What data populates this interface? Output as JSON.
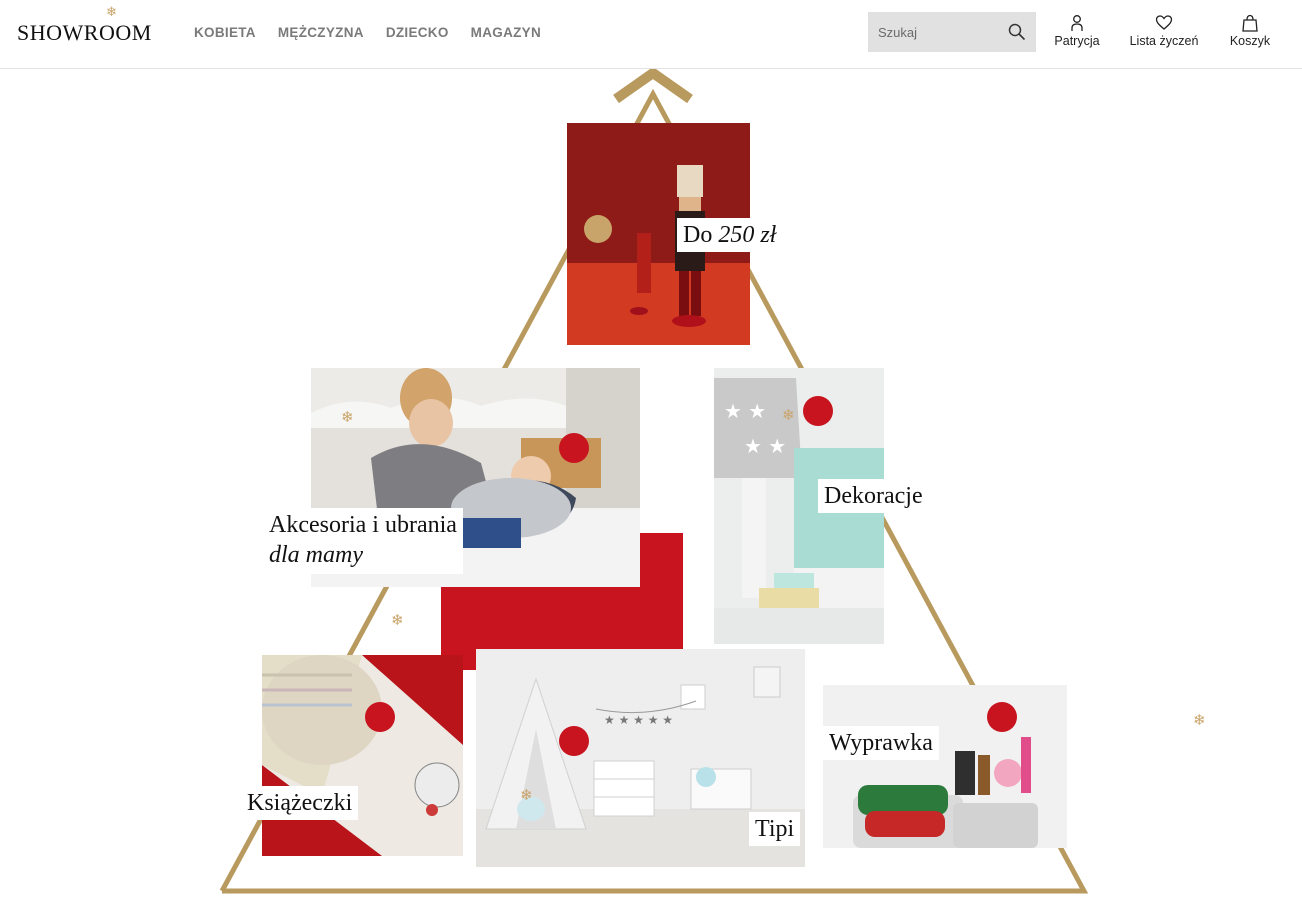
{
  "brand": {
    "logo_text": "SHOWROOM"
  },
  "nav": {
    "items": [
      "KOBIETA",
      "MĘŻCZYZNA",
      "DZIECKO",
      "MAGAZYN"
    ]
  },
  "search": {
    "placeholder": "Szukaj"
  },
  "header_actions": {
    "account": "Patrycja",
    "wishlist": "Lista życzeń",
    "cart": "Koszyk"
  },
  "tiles": {
    "budget": {
      "label_main": "Do ",
      "label_italic": "250 zł"
    },
    "mom": {
      "label_main": "Akcesoria i ubrania",
      "label_italic": "dla mamy"
    },
    "decor": {
      "label": "Dekoracje"
    },
    "books": {
      "label": "Książeczki"
    },
    "tipi": {
      "label": "Tipi"
    },
    "layette": {
      "label": "Wyprawka"
    }
  },
  "colors": {
    "gold": "#b89a5e",
    "red": "#c8141f",
    "nav_gray": "#7a7a7a"
  },
  "icons": {
    "search": "search-icon",
    "account": "user-icon",
    "wishlist": "heart-icon",
    "cart": "bag-icon",
    "snowflake": "snowflake-icon",
    "scroll_up": "chevron-up-icon"
  }
}
